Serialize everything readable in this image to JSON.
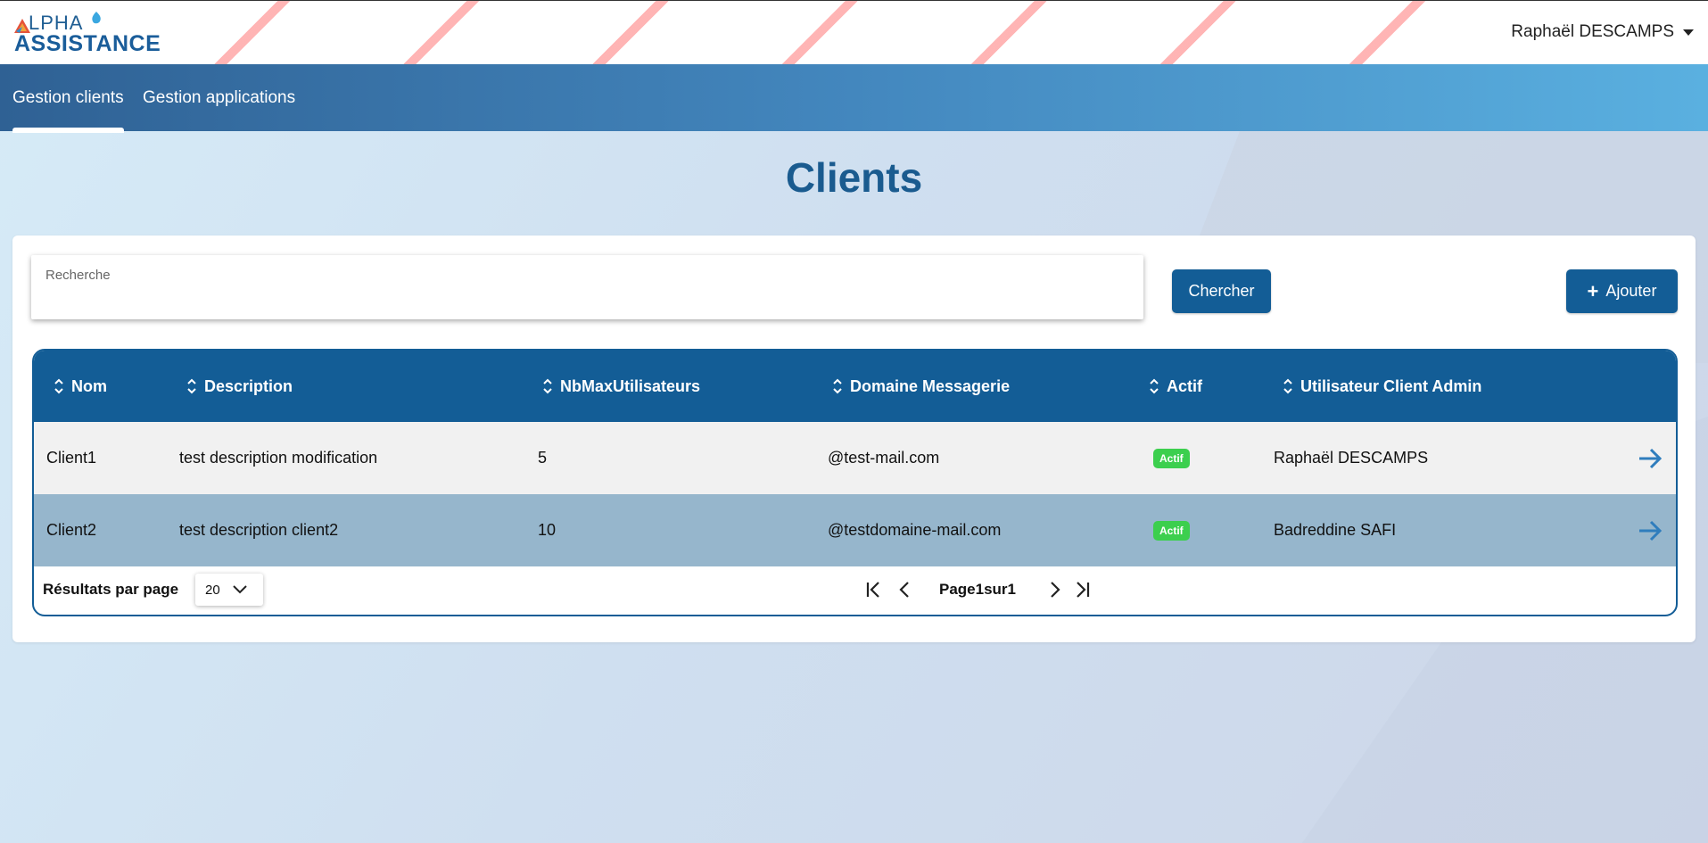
{
  "header": {
    "logo_top": "LPHA",
    "logo_bottom": "ASSISTANCE",
    "user_name": "Raphaël DESCAMPS"
  },
  "nav": {
    "items": [
      {
        "label": "Gestion clients",
        "active": true
      },
      {
        "label": "Gestion applications",
        "active": false
      }
    ]
  },
  "page": {
    "title": "Clients"
  },
  "search": {
    "label": "Recherche",
    "value": "",
    "search_button": "Chercher",
    "add_button": "Ajouter"
  },
  "table": {
    "columns": [
      "Nom",
      "Description",
      "NbMaxUtilisateurs",
      "Domaine Messagerie",
      "Actif",
      "Utilisateur Client Admin"
    ],
    "rows": [
      {
        "nom": "Client1",
        "description": "test description modification",
        "nbmax": "5",
        "domaine": "@test-mail.com",
        "actif": "Actif",
        "admin": "Raphaël DESCAMPS"
      },
      {
        "nom": "Client2",
        "description": "test description client2",
        "nbmax": "10",
        "domaine": "@testdomaine-mail.com",
        "actif": "Actif",
        "admin": "Badreddine SAFI"
      }
    ]
  },
  "pagination": {
    "per_page_label": "Résultats par page",
    "per_page_value": "20",
    "page_text": "Page1sur1"
  },
  "colors": {
    "primary": "#135d96",
    "active_badge": "#3ccf4e",
    "row_selected": "#96b6cc"
  }
}
